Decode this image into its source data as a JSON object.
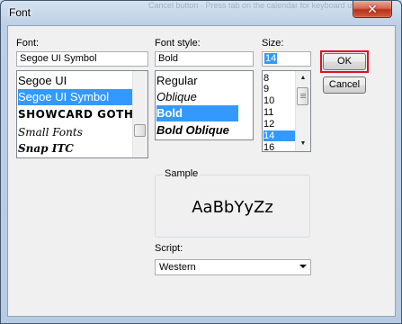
{
  "window": {
    "title": "Font",
    "close_glyph": "✕",
    "ghost_text": "Cancel button · Press tab on the calendar for keyboard use · ..."
  },
  "font": {
    "label": "Font:",
    "value": "Segoe UI Symbol",
    "items": [
      "Segoe UI",
      "Segoe UI Symbol",
      "SHOWCARD GOTHIC",
      "Small Fonts",
      "Snap ITC"
    ],
    "selected": "Segoe UI Symbol"
  },
  "style": {
    "label": "Font style:",
    "value": "Bold",
    "items": [
      "Regular",
      "Oblique",
      "Bold",
      "Bold Oblique"
    ],
    "selected": "Bold"
  },
  "size": {
    "label": "Size:",
    "value": "14",
    "items": [
      "8",
      "9",
      "10",
      "11",
      "12",
      "14",
      "16"
    ],
    "selected": "14"
  },
  "buttons": {
    "ok": "OK",
    "cancel": "Cancel"
  },
  "sample": {
    "label": "Sample",
    "text": "AaBbYyZz"
  },
  "script": {
    "label": "Script:",
    "value": "Western"
  },
  "colors": {
    "selection": "#3399ff",
    "ok_highlight": "#e01020"
  },
  "icons": {
    "scroll_up": "up-arrow-icon",
    "scroll_down": "down-arrow-icon",
    "dropdown": "chevron-down-icon",
    "close": "close-icon"
  }
}
